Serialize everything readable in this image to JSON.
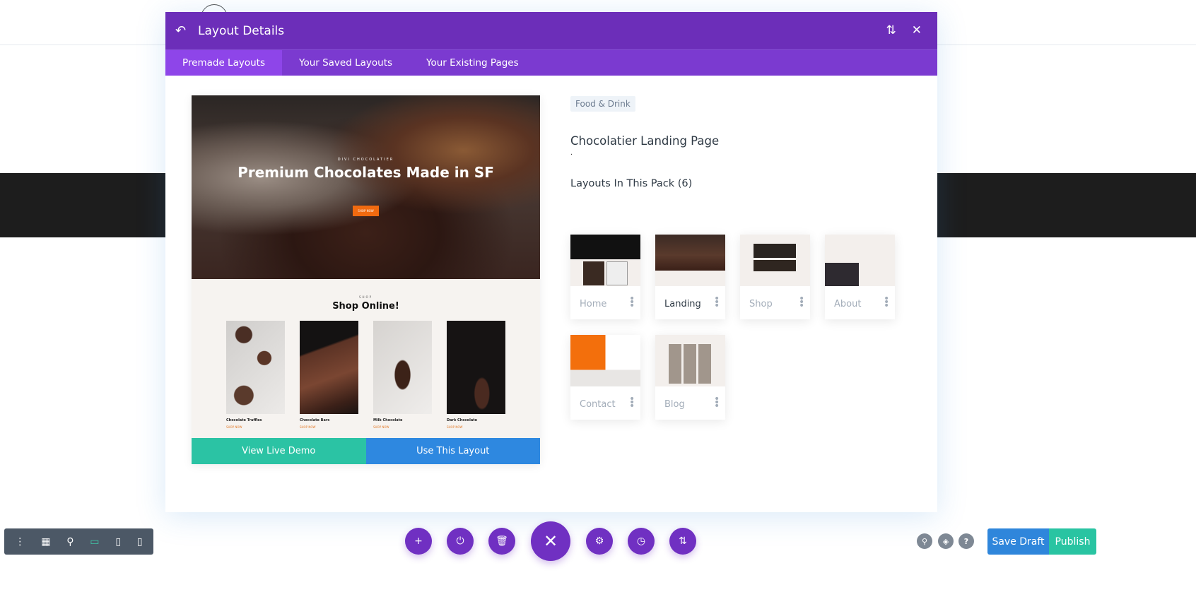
{
  "modal": {
    "title": "Layout Details",
    "tabs": [
      {
        "label": "Premade Layouts",
        "active": true
      },
      {
        "label": "Your Saved Layouts",
        "active": false
      },
      {
        "label": "Your Existing Pages",
        "active": false
      }
    ]
  },
  "preview": {
    "kicker": "DIVI CHOCOLATIER",
    "headline": "Premium Chocolates Made in SF",
    "hero_button": "SHOP NOW",
    "shop_kicker": "SHOP",
    "shop_title": "Shop Online!",
    "products": [
      {
        "name": "Chocolate Truffles",
        "link": "SHOP NOW"
      },
      {
        "name": "Chocolate Bars",
        "link": "SHOP NOW"
      },
      {
        "name": "Milk Chocolate",
        "link": "SHOP NOW"
      },
      {
        "name": "Dark Chocolate",
        "link": "SHOP NOW"
      }
    ],
    "view_demo_label": "View Live Demo",
    "use_layout_label": "Use This Layout"
  },
  "details": {
    "category": "Food & Drink",
    "title": "Chocolatier Landing Page",
    "description": ".",
    "pack_heading": "Layouts In This Pack (6)",
    "layouts": [
      {
        "label": "Home",
        "selected": false
      },
      {
        "label": "Landing",
        "selected": true
      },
      {
        "label": "Shop",
        "selected": false
      },
      {
        "label": "About",
        "selected": false
      },
      {
        "label": "Contact",
        "selected": false
      },
      {
        "label": "Blog",
        "selected": false
      }
    ]
  },
  "footer": {
    "save_draft_label": "Save Draft",
    "publish_label": "Publish"
  },
  "colors": {
    "purple": "#6c2eb9",
    "teal": "#29c4a2",
    "blue": "#2f86db",
    "orange": "#f06a10"
  }
}
